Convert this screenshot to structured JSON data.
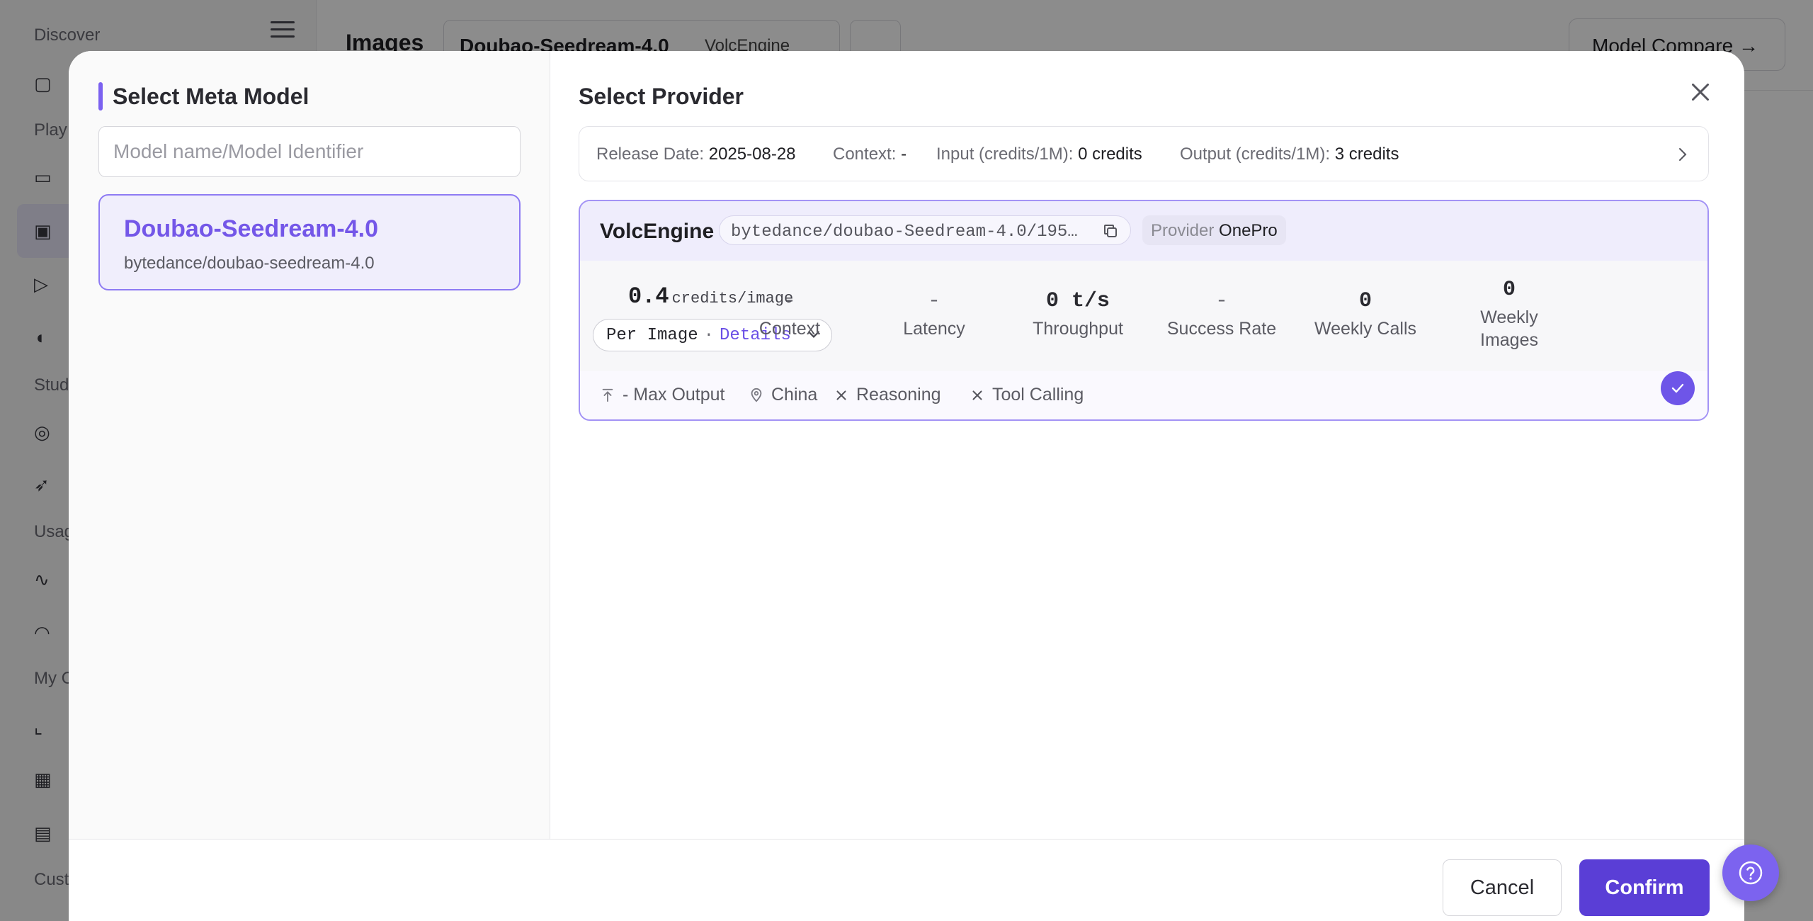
{
  "background": {
    "sidebar": {
      "sections": [
        "Discover",
        "Play",
        "Stud",
        "Usag",
        "My C",
        "Cust"
      ]
    },
    "header": {
      "title": "Images",
      "model_select": {
        "name": "Doubao-Seedream-4.0",
        "provider": "VolcEngine"
      },
      "compare_label": "Model Compare"
    }
  },
  "modal": {
    "left": {
      "title": "Select Meta Model",
      "search_placeholder": "Model name/Model Identifier",
      "models": [
        {
          "name": "Doubao-Seedream-4.0",
          "identifier": "bytedance/doubao-seedream-4.0",
          "selected": true
        }
      ]
    },
    "right": {
      "title": "Select Provider",
      "summary": {
        "release_label": "Release Date:",
        "release_value": "2025-08-28",
        "context_label": "Context:",
        "context_value": "-",
        "input_label": "Input (credits/1M):",
        "input_value": "0 credits",
        "output_label": "Output (credits/1M):",
        "output_value": "3 credits"
      },
      "provider": {
        "name": "VolcEngine",
        "identifier": "bytedance/doubao-Seedream-4.0/195…",
        "tag_key": "Provider",
        "tag_value": "OnePro",
        "price_value": "0.4",
        "price_unit": "credits/image",
        "price_mode": "Per Image",
        "price_sep": "·",
        "details_label": "Details",
        "stats": [
          {
            "value": "-",
            "label": "Context"
          },
          {
            "value": "-",
            "label": "Latency"
          },
          {
            "value": "0 t/s",
            "label": "Throughput"
          },
          {
            "value": "-",
            "label": "Success Rate"
          },
          {
            "value": "0",
            "label": "Weekly Calls"
          },
          {
            "value": "0",
            "label": "Weekly Images"
          }
        ],
        "features": {
          "max_output": "- Max Output",
          "region": "China",
          "reasoning": "Reasoning",
          "tool_calling": "Tool Calling"
        },
        "selected": true
      }
    },
    "footer": {
      "cancel_label": "Cancel",
      "confirm_label": "Confirm"
    }
  },
  "colors": {
    "accent": "#7457e8",
    "primary_button": "#5a3ed6",
    "selected_bg": "#f0eefc"
  },
  "icons": [
    "menu-icon",
    "close-icon",
    "chevron-right-icon",
    "copy-icon",
    "chevron-down-icon",
    "arrow-up-to-line-icon",
    "map-pin-icon",
    "x-icon",
    "check-icon",
    "help-icon",
    "arrow-right-icon"
  ]
}
